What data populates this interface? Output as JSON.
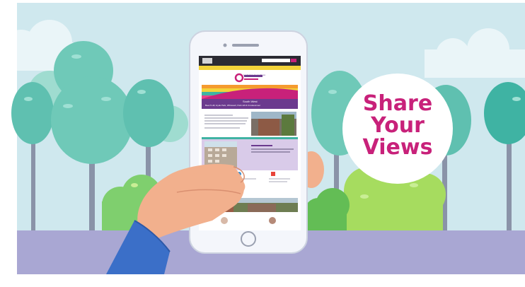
{
  "headline": {
    "line1": "Share",
    "line2": "Your",
    "line3": "Views",
    "color": "#c8217a"
  },
  "phone_screen": {
    "site_brand": "Local Area Committees",
    "banner_title": "South West",
    "banner_subtitle": "Beech Hill, Hyde Park, Whitewell, Park Hill & Crookesmoor",
    "colors": {
      "header": "#2b2b33",
      "nav": "#f3d33a",
      "banner": "#6b3a8e",
      "panel": "#d9cbe9"
    }
  },
  "colors": {
    "sky": "#cfe8ee",
    "ground": "#a9a7d3",
    "magenta": "#c8217a",
    "tree_teal": "#6fc9b8",
    "bush_green": "#7fcf6e",
    "skin": "#f2b08d",
    "sleeve": "#3b6fc8"
  }
}
